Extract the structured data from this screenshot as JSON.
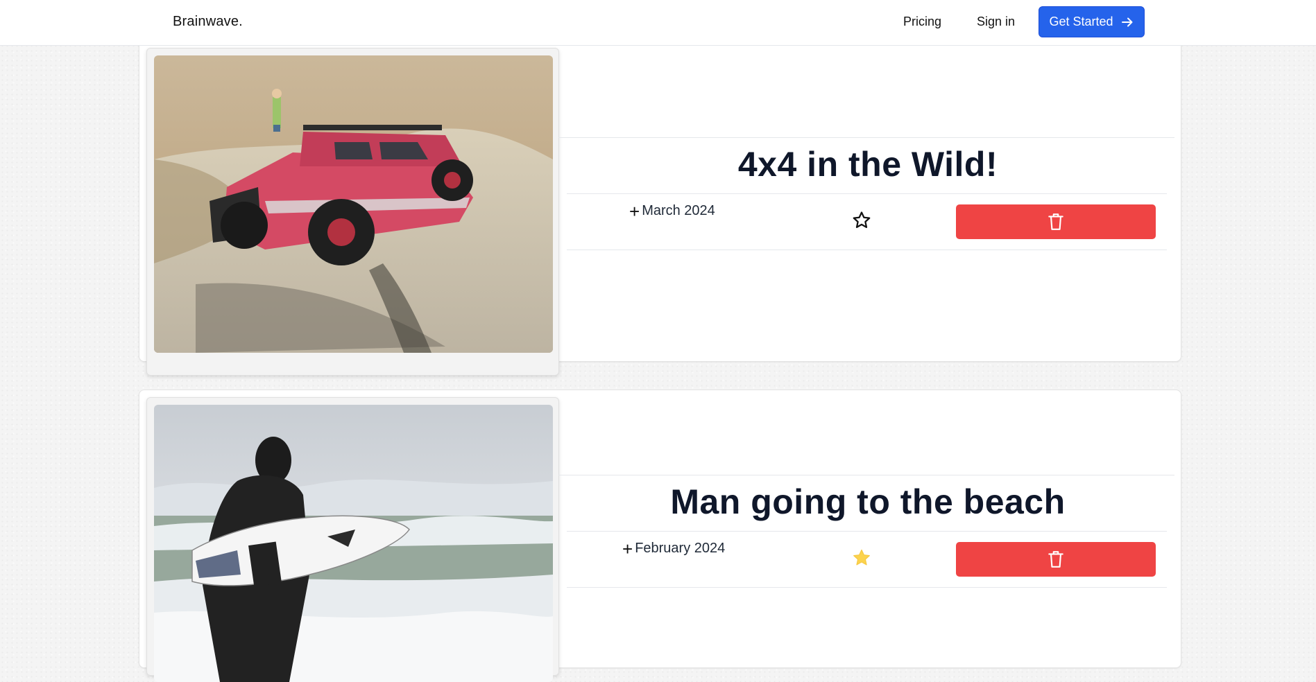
{
  "header": {
    "brand": "Brainwave.",
    "nav": {
      "pricing": "Pricing",
      "sign_in": "Sign in"
    },
    "cta_label": "Get Started",
    "cta_icon": "arrow-right-icon"
  },
  "colors": {
    "accent": "#2563eb",
    "danger": "#ef4444",
    "star_filled": "#fcd34d"
  },
  "posts": [
    {
      "title": "4x4 in the Wild!",
      "date": "March 2024",
      "favorite": false,
      "image": "red off-road jeep climbing a dirt hill"
    },
    {
      "title": "Man going to the beach",
      "date": "February 2024",
      "favorite": true,
      "image": "surfer in wetsuit carrying surfboard toward waves"
    }
  ],
  "icons": {
    "date": "plus-icon",
    "favorite": "star-icon",
    "delete": "trash-icon"
  }
}
